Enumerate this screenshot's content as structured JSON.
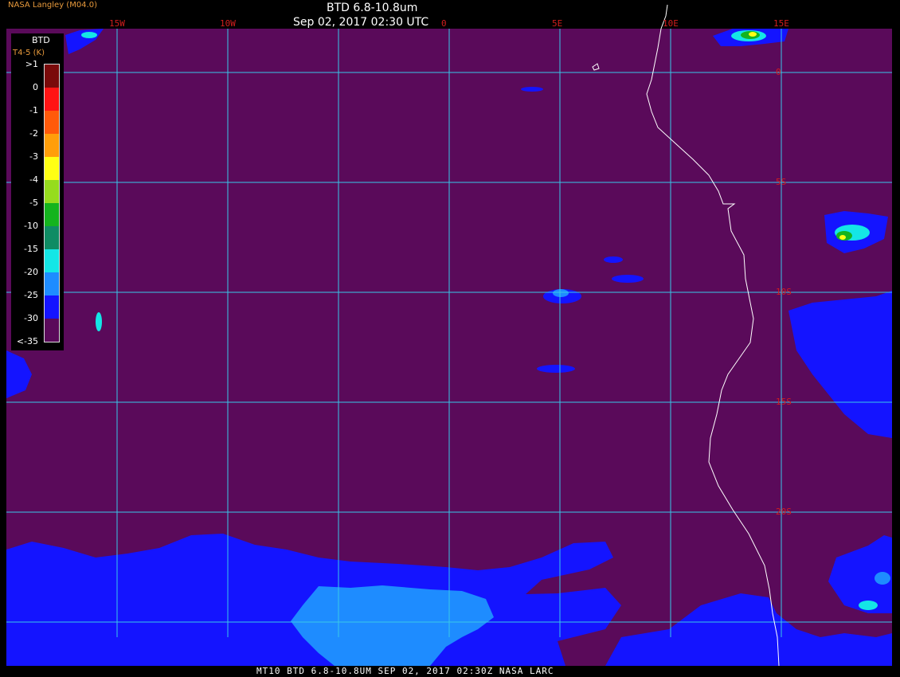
{
  "header": {
    "title": "BTD 6.8-10.8um",
    "subtitle": "Sep 02, 2017 02:30 UTC",
    "credit": "NASA Langley (M04.0)"
  },
  "footer": "MT10  BTD 6.8-10.8UM  SEP 02, 2017 02:30Z  NASA LARC",
  "grid": {
    "longitudes": [
      {
        "value": -15,
        "label": "15W"
      },
      {
        "value": -10,
        "label": "10W"
      },
      {
        "value": -5,
        "label": ""
      },
      {
        "value": 0,
        "label": "0"
      },
      {
        "value": 5,
        "label": "5E"
      },
      {
        "value": 10,
        "label": "10E"
      },
      {
        "value": 15,
        "label": "15E"
      }
    ],
    "latitudes": [
      {
        "value": 0,
        "label": "0"
      },
      {
        "value": -5,
        "label": "5S"
      },
      {
        "value": -10,
        "label": "10S"
      },
      {
        "value": -15,
        "label": "15S"
      },
      {
        "value": -20,
        "label": "20S"
      },
      {
        "value": -25,
        "label": ""
      }
    ],
    "line_color": "#38c8e8"
  },
  "legend": {
    "title": "BTD",
    "subtitle": "T4-5 (K)",
    "ticks": [
      ">1",
      "0",
      "-1",
      "-2",
      "-3",
      "-4",
      "-5",
      "-10",
      "-15",
      "-20",
      "-25",
      "-30",
      "<-35"
    ],
    "colors": [
      "#7a0a0a",
      "#ff1414",
      "#ff5a0a",
      "#ff9e0a",
      "#ffff14",
      "#96dc1e",
      "#14b41e",
      "#0f8c64",
      "#14e6e6",
      "#1e8cff",
      "#1414ff",
      "#5a0a5a"
    ]
  },
  "colors": {
    "background": "#5a0a5a",
    "cloud_deep": "#1414ff",
    "cloud_mid": "#1e8cff",
    "cloud_cyan": "#14e6e6",
    "cloud_green": "#14b41e",
    "cloud_yellow": "#ffff14",
    "coast": "#ffffff"
  }
}
